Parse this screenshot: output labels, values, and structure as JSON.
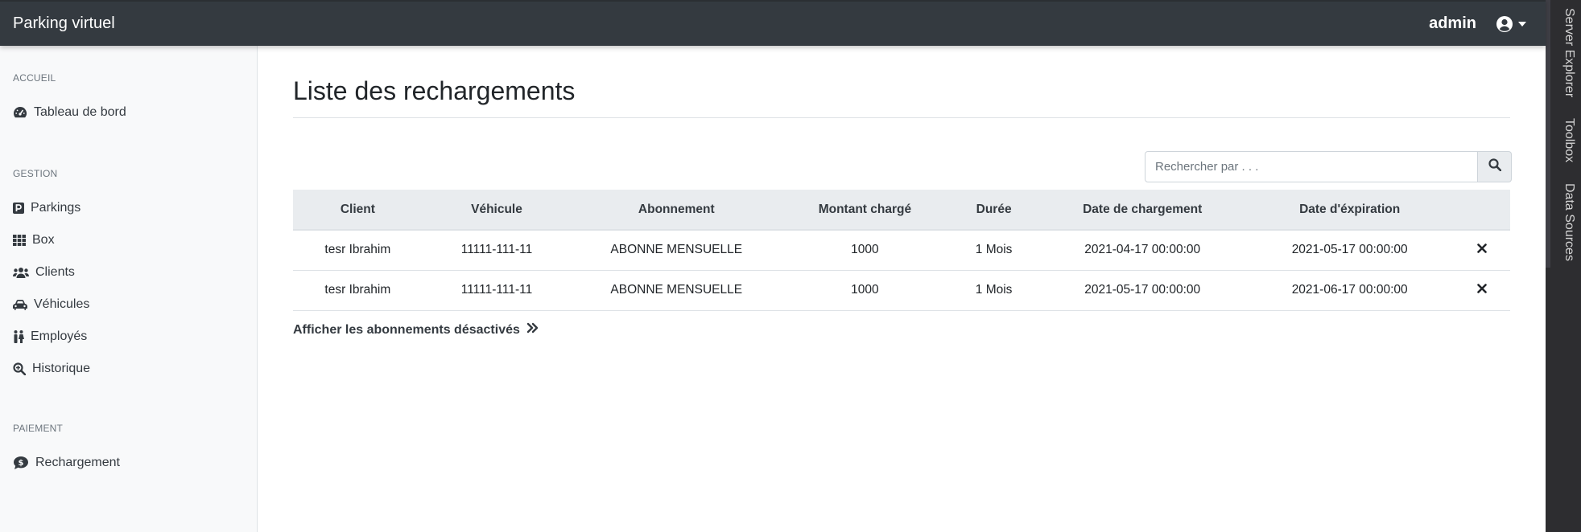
{
  "app": {
    "title": "Parking virtuel"
  },
  "user": {
    "name": "admin",
    "icon": "user-circle-icon"
  },
  "sidebar": {
    "sections": [
      {
        "heading": "ACCUEIL",
        "items": [
          {
            "label": "Tableau de bord",
            "icon": "tachometer-icon"
          }
        ]
      },
      {
        "heading": "GESTION",
        "items": [
          {
            "label": "Parkings",
            "icon": "parking-icon"
          },
          {
            "label": "Box",
            "icon": "grid-icon"
          },
          {
            "label": "Clients",
            "icon": "users-icon"
          },
          {
            "label": "Véhicules",
            "icon": "car-icon"
          },
          {
            "label": "Employés",
            "icon": "people-icon"
          },
          {
            "label": "Historique",
            "icon": "search-plus-icon"
          }
        ]
      },
      {
        "heading": "PAIEMENT",
        "items": [
          {
            "label": "Rechargement",
            "icon": "dollar-comment-icon"
          }
        ]
      }
    ]
  },
  "main": {
    "title": "Liste des rechargements",
    "search": {
      "placeholder": "Rechercher par . . .",
      "value": ""
    },
    "table": {
      "columns": [
        "Client",
        "Véhicule",
        "Abonnement",
        "Montant chargé",
        "Durée",
        "Date de chargement",
        "Date d'éxpiration",
        ""
      ],
      "rows": [
        [
          "tesr Ibrahim",
          "11111-111-11",
          "ABONNE MENSUELLE",
          "1000",
          "1 Mois",
          "2021-04-17 00:00:00",
          "2021-05-17 00:00:00"
        ],
        [
          "tesr Ibrahim",
          "11111-111-11",
          "ABONNE MENSUELLE",
          "1000",
          "1 Mois",
          "2021-05-17 00:00:00",
          "2021-06-17 00:00:00"
        ]
      ]
    },
    "show_disabled_link": "Afficher les abonnements désactivés"
  },
  "ide_rail": {
    "tabs": [
      "Server Explorer",
      "Toolbox",
      "Data Sources"
    ]
  },
  "colors": {
    "navbar": "#343a40",
    "sidebar": "#f8f9fa",
    "table_header": "#e9ecef",
    "rail": "#2d2d30"
  }
}
